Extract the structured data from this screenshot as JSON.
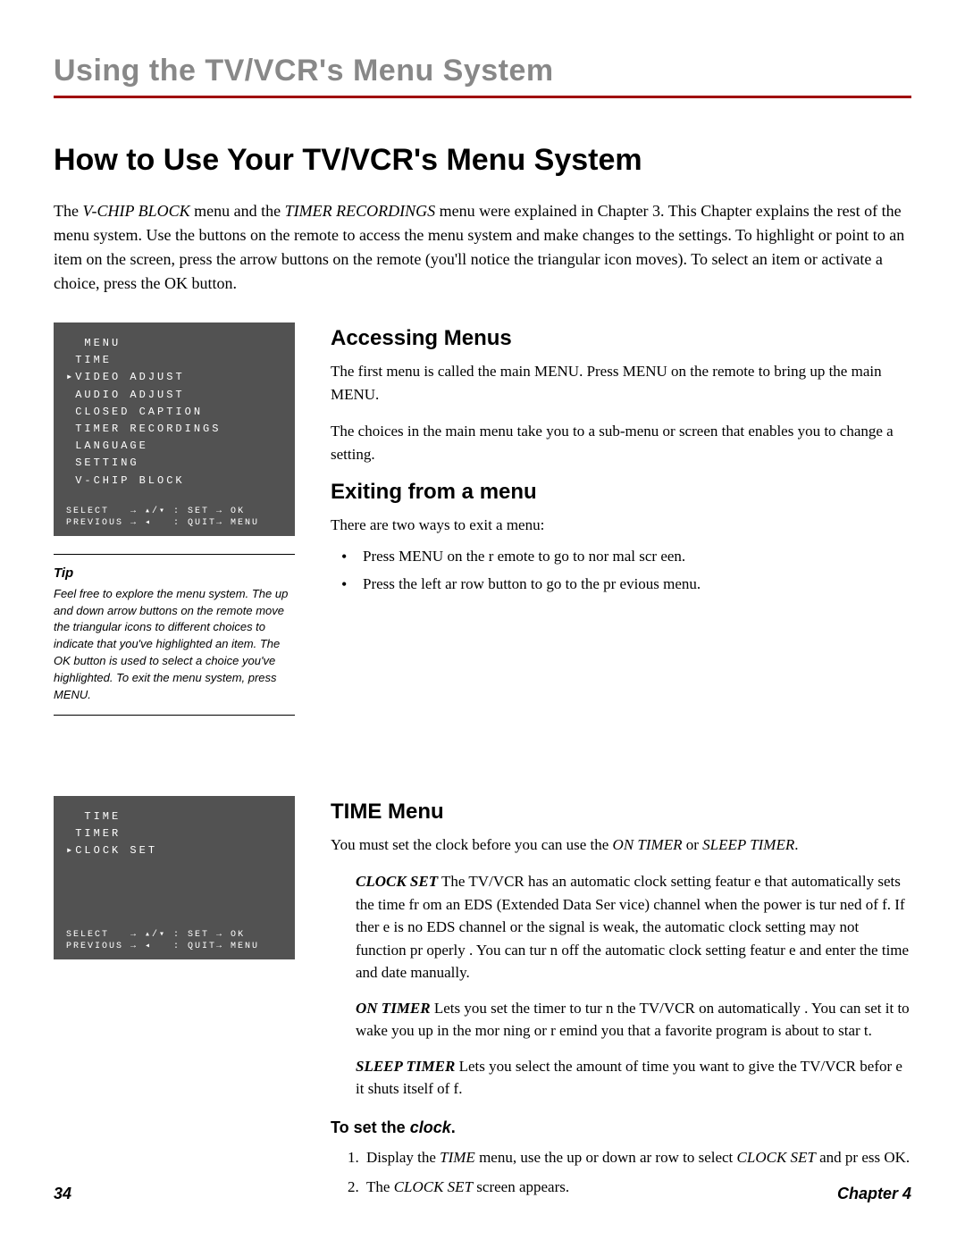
{
  "chapter_title": "Using the TV/VCR's Menu System",
  "main_heading": "How to Use Your TV/VCR's Menu System",
  "intro": {
    "part1": "The ",
    "italic1": "V-CHIP BLOCK",
    "part2": " menu and the ",
    "italic2": "TIMER RECORDINGS",
    "part3": " menu were explained in Chapter 3. This Chapter explains the rest of the menu system. Use the buttons on the remote to access the menu system and make changes to the settings. To highlight or point to an item on the screen, press the arrow buttons on the remote (you'll notice the triangular icon moves). To select an item or activate a choice, press the OK button."
  },
  "menu1": {
    "lines": [
      "  MENU",
      " TIME",
      "▸VIDEO ADJUST",
      " AUDIO ADJUST",
      " CLOSED CAPTION",
      " TIMER RECORDINGS",
      " LANGUAGE",
      " SETTING",
      " V-CHIP BLOCK"
    ],
    "footer1": "SELECT   → ▴/▾ : SET → OK",
    "footer2": "PREVIOUS → ◂   : QUIT→ MENU"
  },
  "tip": {
    "label": "Tip",
    "text": "Feel free to explore the menu system. The up and down arrow buttons on the remote move the triangular icons to different choices to indicate that you've highlighted an item. The OK button is used to select a choice you've highlighted. To exit the menu system, press MENU."
  },
  "accessing": {
    "heading": "Accessing Menus",
    "p1": "The first menu is called the main MENU. Press MENU on the remote to bring up the main MENU.",
    "p2": "The choices in the main menu take you to a sub-menu or screen that enables you to change a setting."
  },
  "exiting": {
    "heading": "Exiting from a menu",
    "p1": "There are two ways to exit a menu:",
    "bullet1": "Press MENU on the r emote to go to nor mal scr een.",
    "bullet2": "Press the left ar row button to go to the pr evious menu."
  },
  "menu2": {
    "lines": [
      "  TIME",
      "",
      " TIMER",
      "▸CLOCK SET"
    ],
    "footer1": "SELECT   → ▴/▾ : SET → OK",
    "footer2": "PREVIOUS → ◂   : QUIT→ MENU"
  },
  "timemenu": {
    "heading": "TIME Menu",
    "intro_a": "You must set the clock before you can use the ",
    "intro_i1": "ON TIMER",
    "intro_b": " or ",
    "intro_i2": "SLEEP TIMER",
    "intro_c": ".",
    "clockset_label": "CLOCK SET",
    "clockset_text": "  The TV/VCR has an automatic clock setting featur e that automatically sets the time fr om an EDS (Extended Data Ser vice) channel when the power is tur ned of f. If ther e is no EDS channel or the signal is weak, the automatic clock setting may not function pr operly . You can tur n off the automatic clock setting featur e and enter the time and date manually.",
    "ontimer_label": "ON TIMER",
    "ontimer_text": "  Lets you set the timer to tur n the TV/VCR on automatically . You can set it to wake you up in the mor ning or r emind you that a favorite program is about to star t.",
    "sleep_label": "SLEEP TIMER",
    "sleep_text": "  Lets you select the amount of time you want to give the TV/VCR befor e it shuts itself of f.",
    "setclock_heading_a": "To set the ",
    "setclock_heading_i": "clock",
    "setclock_heading_b": ".",
    "step1_a": "Display the ",
    "step1_i1": "TIME",
    "step1_b": " menu, use the up or down ar row to select ",
    "step1_i2": "CLOCK SET",
    "step1_c": " and pr ess OK.",
    "step2_a": "The ",
    "step2_i": "CLOCK SET",
    "step2_b": " screen appears."
  },
  "footer": {
    "page": "34",
    "chapter": "Chapter 4"
  }
}
